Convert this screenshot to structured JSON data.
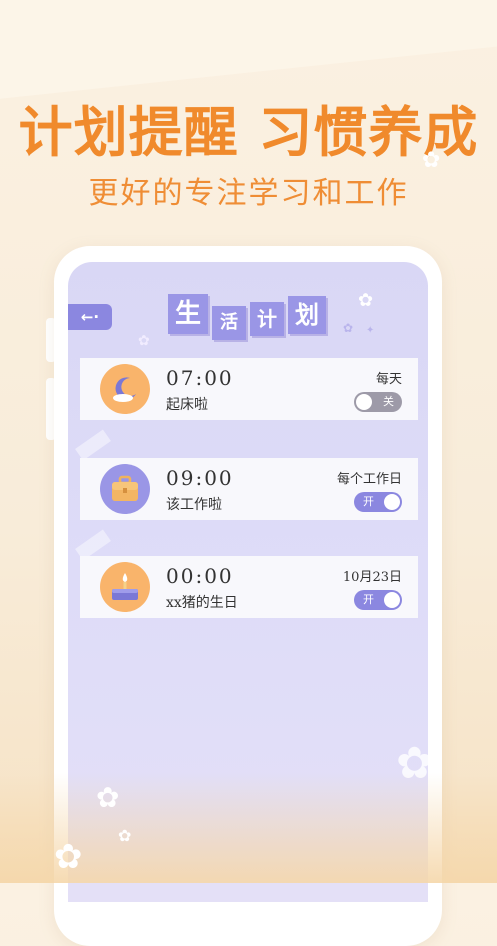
{
  "promo": {
    "headline": "计划提醒 习惯养成",
    "subline": "更好的专注学习和工作"
  },
  "screen": {
    "back_label": "←·",
    "title_chars": [
      "生",
      "活",
      "计",
      "划"
    ]
  },
  "reminders": [
    {
      "time": "07:00",
      "label": "起床啦",
      "repeat": "每天",
      "toggle_text": "关",
      "enabled": false,
      "icon": "moon-icon"
    },
    {
      "time": "09:00",
      "label": "该工作啦",
      "repeat": "每个工作日",
      "toggle_text": "开",
      "enabled": true,
      "icon": "briefcase-icon"
    },
    {
      "time": "00:00",
      "label": "xx猪的生日",
      "repeat": "10月23日",
      "toggle_text": "开",
      "enabled": true,
      "icon": "birthday-cake-icon"
    }
  ],
  "colors": {
    "accent_orange": "#f08a2c",
    "accent_purple": "#8b87e0",
    "toggle_off": "#9d9aa8",
    "icon_orange_bg": "#f9b46b"
  }
}
